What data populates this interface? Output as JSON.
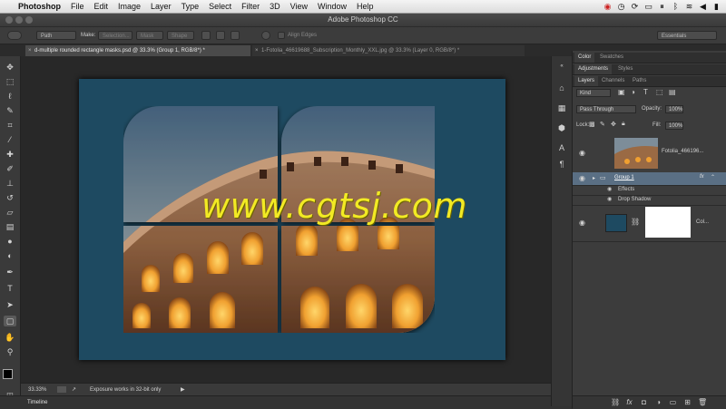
{
  "menubar": {
    "app_name": "Photoshop",
    "items": [
      "File",
      "Edit",
      "Image",
      "Layer",
      "Type",
      "Select",
      "Filter",
      "3D",
      "View",
      "Window",
      "Help"
    ]
  },
  "window": {
    "title": "Adobe Photoshop CC"
  },
  "options": {
    "mode_value": "Path",
    "make_label": "Make:",
    "selection_label": "Selection...",
    "mask_label": "Mask",
    "shape_label": "Shape",
    "align_edges_label": "Align Edges",
    "workspace_value": "Essentials"
  },
  "tabs": [
    {
      "label": "d-multiple rounded rectangle masks.psd @ 33.3% (Group 1, RGB/8*) *",
      "active": true
    },
    {
      "label": "1-Fotolia_46619688_Subscription_Monthly_XXL.jpg @ 33.3% (Layer 0, RGB/8*) *",
      "active": false
    }
  ],
  "watermark": "www.cgtsj.com",
  "status": {
    "zoom": "33.33%",
    "message": "Exposure works in 32-bit only",
    "timeline_label": "Timeline"
  },
  "panels": {
    "color_tabs": [
      "Color",
      "Swatches"
    ],
    "adjust_tabs": [
      "Adjustments",
      "Styles"
    ],
    "layer_tabs": [
      "Layers",
      "Channels",
      "Paths"
    ],
    "filter_kind": "Kind",
    "blend_mode": "Pass Through",
    "opacity_label": "Opacity:",
    "opacity_value": "100%",
    "lock_label": "Lock:",
    "fill_label": "Fill:",
    "fill_value": "100%",
    "layers": [
      {
        "name": "Fotolia_466196...",
        "type": "image"
      },
      {
        "name": "Group 1",
        "type": "group"
      },
      {
        "name": "Effects",
        "type": "effects"
      },
      {
        "name": "Drop Shadow",
        "type": "effect"
      },
      {
        "name": "Col...",
        "type": "fill"
      }
    ]
  },
  "colors": {
    "document_bg": "#1e4a61",
    "watermark": "#f2ea24",
    "selected_layer": "#5a6f84"
  }
}
